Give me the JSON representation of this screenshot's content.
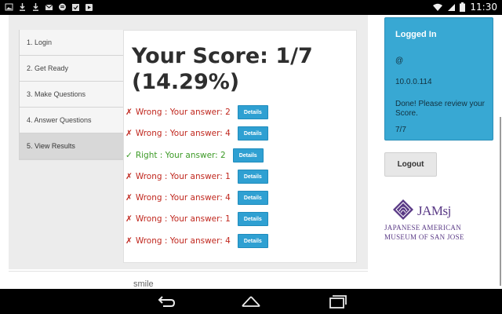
{
  "status_bar": {
    "time": "11:30",
    "left_icons": [
      "image-icon",
      "download-icon",
      "download-icon",
      "gmail-icon",
      "spotify-icon",
      "calendar-check-icon",
      "play-store-icon"
    ],
    "right_icons": [
      "wifi-icon",
      "signal-icon",
      "battery-icon"
    ]
  },
  "steps": [
    {
      "label": "1. Login",
      "active": false
    },
    {
      "label": "2. Get Ready",
      "active": false
    },
    {
      "label": "3. Make Questions",
      "active": false
    },
    {
      "label": "4. Answer Questions",
      "active": false
    },
    {
      "label": "5. View Results",
      "active": true
    }
  ],
  "results": {
    "score_line1": "Your Score: 1/7",
    "score_line2": "(14.29%)",
    "details_label": "Details",
    "rows": [
      {
        "mark": "✗",
        "text": "Wrong : Your answer: 2",
        "status": "wrong"
      },
      {
        "mark": "✗",
        "text": "Wrong : Your answer: 4",
        "status": "wrong"
      },
      {
        "mark": "✓",
        "text": "Right : Your answer: 2",
        "status": "right"
      },
      {
        "mark": "✗",
        "text": "Wrong : Your answer: 1",
        "status": "wrong"
      },
      {
        "mark": "✗",
        "text": "Wrong : Your answer: 4",
        "status": "wrong"
      },
      {
        "mark": "✗",
        "text": "Wrong : Your answer: 1",
        "status": "wrong"
      },
      {
        "mark": "✗",
        "text": "Wrong : Your answer: 4",
        "status": "wrong"
      }
    ]
  },
  "login_box": {
    "title": "Logged In",
    "user": "@",
    "ip": "10.0.0.114",
    "message": "Done! Please review your Score.",
    "score": "7/7"
  },
  "logout_label": "Logout",
  "logo": {
    "name": "JAMsj",
    "line1": "JAPANESE AMERICAN",
    "line2": "MUSEUM OF SAN JOSE"
  },
  "footer_text": "smile",
  "colors": {
    "wrong": "#c0271e",
    "right": "#3c9a26",
    "details_button": "#2fa0d2",
    "login_box": "#38a8d3",
    "logo": "#5a3a86"
  }
}
